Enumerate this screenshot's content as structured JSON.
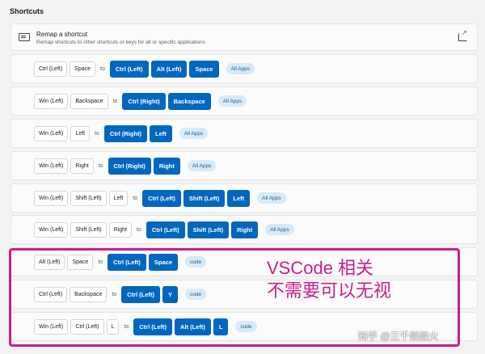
{
  "section_title": "Shortcuts",
  "remap": {
    "title": "Remap a shortcut",
    "subtitle": "Remap shortcuts to other shortcuts or keys for all or specific applications",
    "icon": "keyboard-icon",
    "open_icon": "open-external-icon"
  },
  "to_label": "to",
  "shortcuts": [
    {
      "from": [
        "Ctrl (Left)",
        "Space"
      ],
      "to": [
        "Ctrl (Left)",
        "Alt (Left)",
        "Space"
      ],
      "app": "All Apps"
    },
    {
      "from": [
        "Win (Left)",
        "Backspace"
      ],
      "to": [
        "Ctrl (Right)",
        "Backspace"
      ],
      "app": "All Apps"
    },
    {
      "from": [
        "Win (Left)",
        "Left"
      ],
      "to": [
        "Ctrl (Right)",
        "Left"
      ],
      "app": "All Apps"
    },
    {
      "from": [
        "Win (Left)",
        "Right"
      ],
      "to": [
        "Ctrl (Right)",
        "Right"
      ],
      "app": "All Apps"
    },
    {
      "from": [
        "Win (Left)",
        "Shift (Left)",
        "Left"
      ],
      "to": [
        "Ctrl (Left)",
        "Shift (Left)",
        "Left"
      ],
      "app": "All Apps"
    },
    {
      "from": [
        "Win (Left)",
        "Shift (Left)",
        "Right"
      ],
      "to": [
        "Ctrl (Left)",
        "Shift (Left)",
        "Right"
      ],
      "app": "All Apps"
    },
    {
      "from": [
        "Alt (Left)",
        "Space"
      ],
      "to": [
        "Ctrl (Left)",
        "Space"
      ],
      "app": "code"
    },
    {
      "from": [
        "Ctrl (Left)",
        "Backspace"
      ],
      "to": [
        "Ctrl (Left)",
        "Y"
      ],
      "app": "code"
    },
    {
      "from": [
        "Win (Left)",
        "Ctrl (Left)",
        "L"
      ],
      "to": [
        "Ctrl (Left)",
        "Alt (Left)",
        "L"
      ],
      "app": "code"
    }
  ],
  "annotation": {
    "line1": "VSCode 相关",
    "line2": "不需要可以无视",
    "color": "#c8208a"
  },
  "watermark": "知乎 @三千燚燚火",
  "colors": {
    "accent": "#0067c0",
    "badge_bg": "#d7eaf7"
  }
}
